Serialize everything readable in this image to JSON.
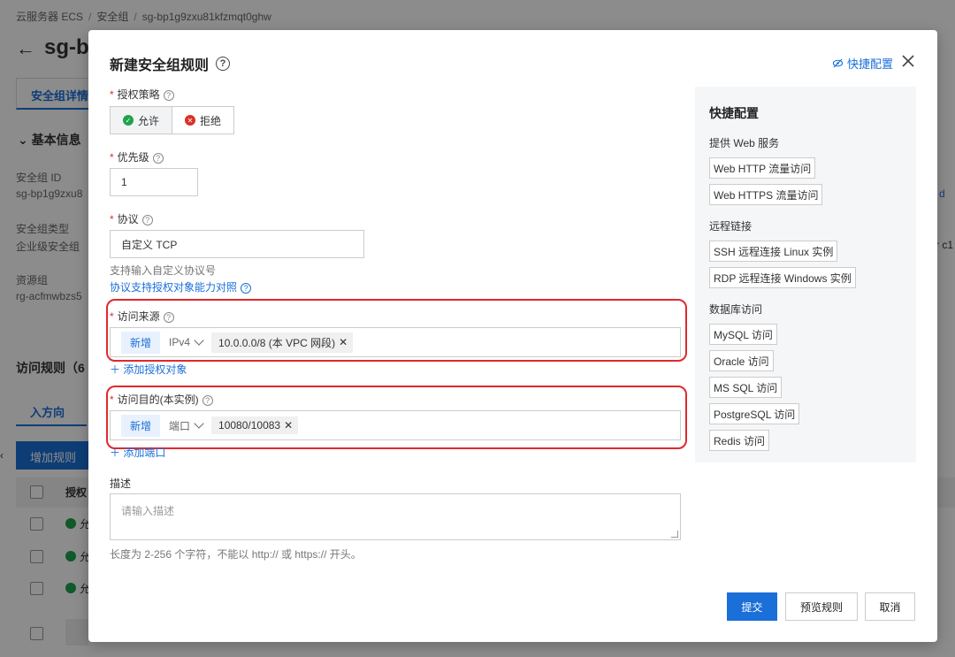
{
  "background": {
    "breadcrumb": [
      "云服务器 ECS",
      "安全组",
      "sg-bp1g9zxu81kfzmqt0ghw"
    ],
    "title": "sg-b",
    "tab": "安全组详情",
    "section": "基本信息",
    "fields": [
      {
        "label": "安全组 ID",
        "value": "sg-bp1g9zxu8"
      },
      {
        "label": "安全组类型",
        "value": "企业级安全组"
      },
      {
        "label": "资源组",
        "value": "rg-acfmwbzs5"
      }
    ],
    "rules_title": "访问规则（6",
    "inbound_tab": "入方向",
    "add_rule_button": "增加规则",
    "table_header": "授权",
    "row_status": "允",
    "right_peek_1": "d",
    "right_peek_2": "r c1"
  },
  "modal": {
    "title": "新建安全组规则",
    "quick_config_link": "快捷配置",
    "policy": {
      "label": "授权策略",
      "allow": "允许",
      "deny": "拒绝"
    },
    "priority": {
      "label": "优先级",
      "value": "1"
    },
    "protocol": {
      "label": "协议",
      "value": "自定义 TCP",
      "hint": "支持输入自定义协议号",
      "link": "协议支持授权对象能力对照"
    },
    "source": {
      "label": "访问来源",
      "new_tag": "新增",
      "selector": "IPv4",
      "chip": "10.0.0.0/8 (本 VPC 网段)",
      "add_link": "添加授权对象"
    },
    "destination": {
      "label": "访问目的(本实例)",
      "new_tag": "新增",
      "selector": "端口",
      "chip": "10080/10083",
      "add_link": "添加端口"
    },
    "description": {
      "label": "描述",
      "placeholder": "请输入描述",
      "hint": "长度为 2-256 个字符，不能以 http:// 或 https:// 开头。"
    },
    "buttons": {
      "submit": "提交",
      "preview": "预览规则",
      "cancel": "取消"
    },
    "panel": {
      "title": "快捷配置",
      "groups": [
        {
          "name": "提供 Web 服务",
          "items": [
            "Web HTTP 流量访问",
            "Web HTTPS 流量访问"
          ]
        },
        {
          "name": "远程链接",
          "items": [
            "SSH 远程连接 Linux 实例",
            "RDP 远程连接 Windows 实例"
          ]
        },
        {
          "name": "数据库访问",
          "items": [
            "MySQL 访问",
            "Oracle 访问",
            "MS SQL 访问",
            "PostgreSQL 访问",
            "Redis 访问"
          ]
        }
      ]
    }
  }
}
